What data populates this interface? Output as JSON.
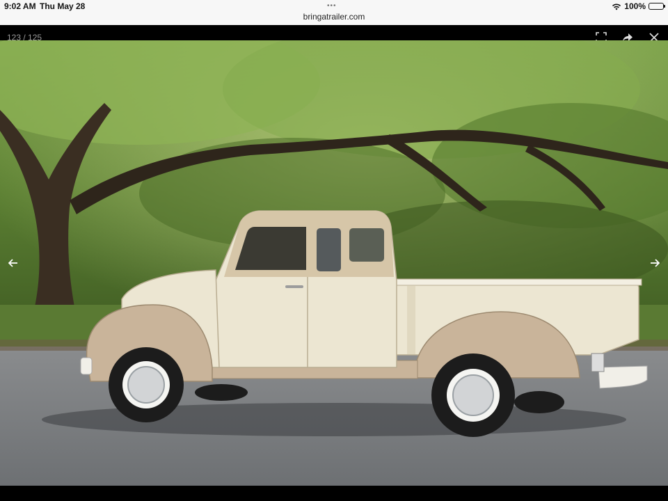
{
  "status_bar": {
    "time": "9:02 AM",
    "date": "Thu May 28",
    "url": "bringatrailer.com",
    "battery": "100%",
    "dots": "•••"
  },
  "viewer": {
    "counter": "123 / 125",
    "icons": {
      "fullscreen": "fullscreen-icon",
      "share": "share-icon",
      "close": "close-icon",
      "prev": "chevron-left-icon",
      "next": "chevron-right-icon"
    }
  },
  "photo": {
    "subject": "vintage-pickup-truck"
  },
  "colors": {
    "statusbar_bg": "#f7f7f7",
    "viewer_bg": "#000000",
    "truck_cream": "#ece6d2",
    "truck_tan": "#c9b49a"
  }
}
